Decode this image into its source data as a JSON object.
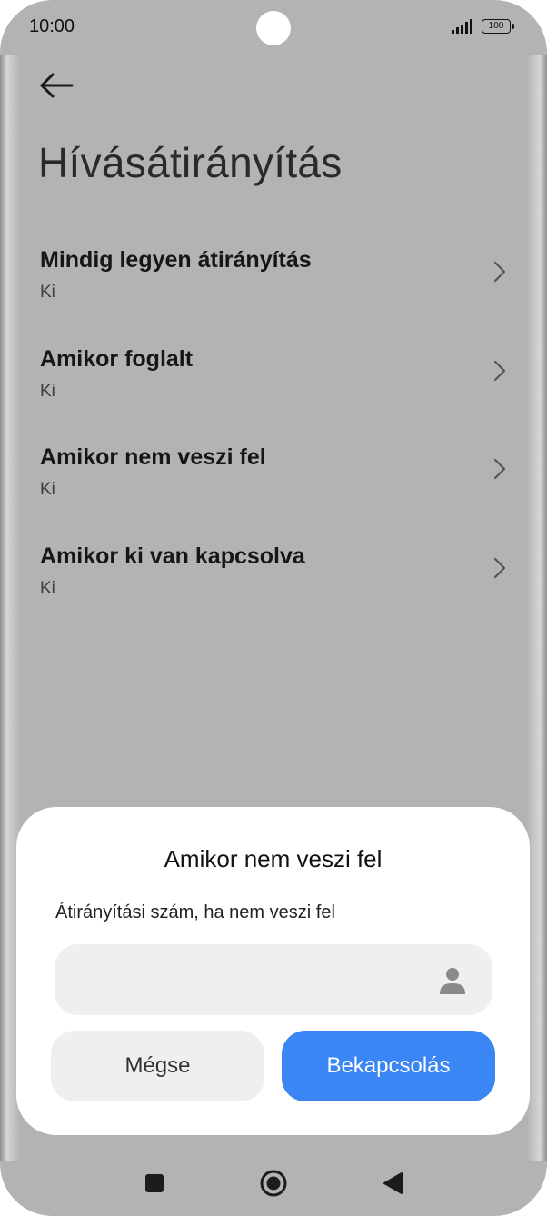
{
  "status_bar": {
    "time": "10:00",
    "battery": "100",
    "signal_icon": "signal-icon",
    "battery_icon": "battery-icon"
  },
  "header": {
    "back_icon": "arrow-left-icon",
    "title": "Hívásátirányítás"
  },
  "menu": {
    "items": [
      {
        "title": "Mindig legyen átirányítás",
        "status": "Ki"
      },
      {
        "title": "Amikor foglalt",
        "status": "Ki"
      },
      {
        "title": "Amikor nem veszi fel",
        "status": "Ki"
      },
      {
        "title": "Amikor ki van kapcsolva",
        "status": "Ki"
      }
    ],
    "chevron_icon": "chevron-right-icon"
  },
  "dialog": {
    "title": "Amikor nem veszi fel",
    "field_label": "Átirányítási szám, ha nem veszi fel",
    "field_value": "",
    "contact_icon": "person-icon",
    "cancel_label": "Mégse",
    "confirm_label": "Bekapcsolás",
    "confirm_color": "#3a86f5"
  },
  "nav_bar": {
    "recents_icon": "square-icon",
    "home_icon": "circle-icon",
    "back_icon": "triangle-back-icon"
  }
}
